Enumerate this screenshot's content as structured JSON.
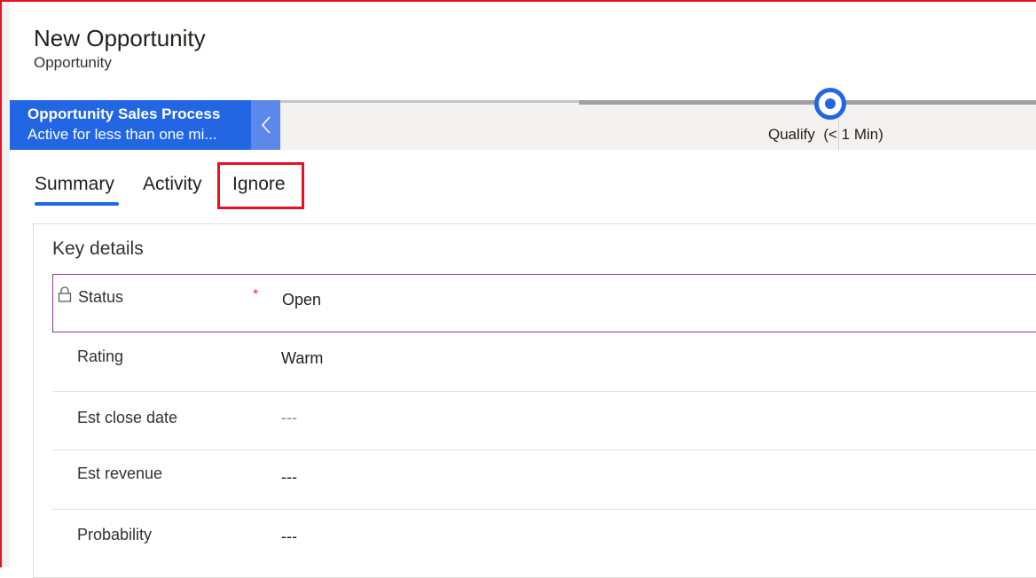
{
  "header": {
    "title": "New Opportunity",
    "subtitle": "Opportunity"
  },
  "process": {
    "name": "Opportunity Sales Process",
    "status": "Active for less than one mi...",
    "stage_name": "Qualify",
    "stage_time": "(< 1 Min)"
  },
  "tabs": [
    {
      "label": "Summary",
      "selected": true
    },
    {
      "label": "Activity",
      "selected": false
    },
    {
      "label": "Ignore",
      "selected": false,
      "highlighted": true
    }
  ],
  "section": {
    "title": "Key details",
    "fields": [
      {
        "label": "Status",
        "value": "Open",
        "required": true,
        "locked": true
      },
      {
        "label": "Rating",
        "value": "Warm"
      },
      {
        "label": "Est close date",
        "value": "---"
      },
      {
        "label": "Est revenue",
        "value": "---"
      },
      {
        "label": "Probability",
        "value": "---"
      }
    ]
  },
  "colors": {
    "accent": "#2266e3",
    "highlight": "#e81123",
    "focus_border": "#8a3d8f"
  }
}
